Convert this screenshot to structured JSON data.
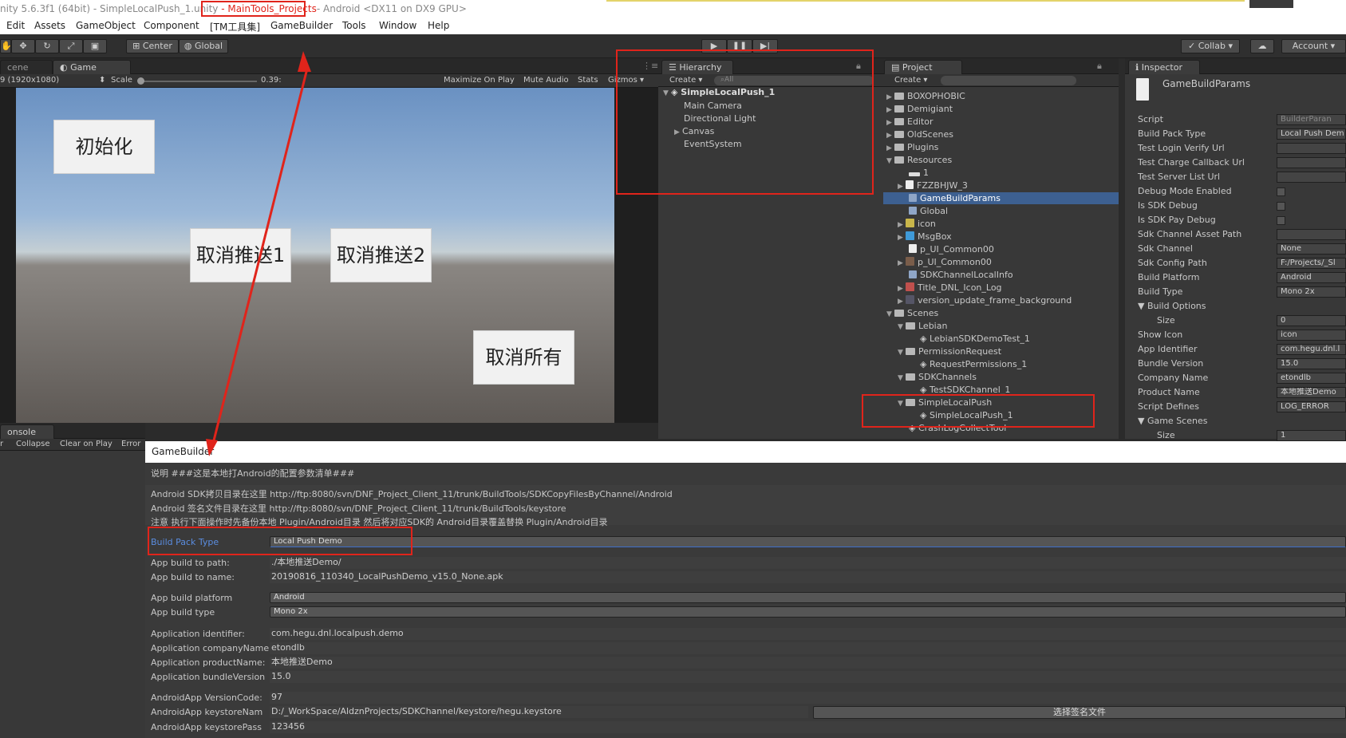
{
  "window": {
    "title": "nity 5.6.3f1 (64bit) - SimpleLocalPush_1.unity ",
    "project": "- MainTools_Projects",
    "platform": "- Android <DX11 on DX9 GPU>"
  },
  "menu": [
    "Edit",
    "Assets",
    "GameObject",
    "Component",
    "[TM工具集]",
    "GameBuilder",
    "Tools",
    "Window",
    "Help"
  ],
  "toolbar": {
    "center": "Center",
    "global": "Global",
    "collab": "Collab ▾",
    "account": "Account"
  },
  "scene_tabs": {
    "scene": "cene",
    "game": "Game"
  },
  "game_toolbar": {
    "resolution": "9 (1920x1080)",
    "scale_label": "Scale",
    "scale_value": "0.39:",
    "maximize": "Maximize On Play",
    "mute": "Mute Audio",
    "stats": "Stats",
    "gizmos": "Gizmos ▾"
  },
  "game_buttons": {
    "init": "初始化",
    "cancel1": "取消推送1",
    "cancel2": "取消推送2",
    "cancel_all": "取消所有"
  },
  "console": {
    "tab": "onsole",
    "buttons": [
      "r",
      "Collapse",
      "Clear on Play",
      "Error"
    ]
  },
  "hierarchy": {
    "tab": "Hierarchy",
    "create": "Create ▾",
    "search_placeholder": "All",
    "scene": "SimpleLocalPush_1",
    "items": [
      "Main Camera",
      "Directional Light",
      "Canvas",
      "EventSystem"
    ]
  },
  "project": {
    "tab": "Project",
    "create": "Create ▾",
    "items": [
      {
        "label": "BOXOPHOBIC"
      },
      {
        "label": "Demigiant"
      },
      {
        "label": "Editor"
      },
      {
        "label": "OldScenes"
      },
      {
        "label": "Plugins"
      },
      {
        "label": "Resources"
      },
      {
        "label": "1"
      },
      {
        "label": "FZZBHJW_3"
      },
      {
        "label": "GameBuildParams"
      },
      {
        "label": "Global"
      },
      {
        "label": "icon"
      },
      {
        "label": "MsgBox"
      },
      {
        "label": "p_UI_Common00"
      },
      {
        "label": "p_UI_Common00"
      },
      {
        "label": "SDKChannelLocalInfo"
      },
      {
        "label": "Title_DNL_Icon_Log"
      },
      {
        "label": "version_update_frame_background"
      },
      {
        "label": "Scenes"
      },
      {
        "label": "Lebian"
      },
      {
        "label": "LebianSDKDemoTest_1"
      },
      {
        "label": "PermissionRequest"
      },
      {
        "label": "RequestPermissions_1"
      },
      {
        "label": "SDKChannels"
      },
      {
        "label": "TestSDKChannel_1"
      },
      {
        "label": "SimpleLocalPush"
      },
      {
        "label": "SimpleLocalPush_1"
      },
      {
        "label": "CrashLogCollectTool"
      }
    ]
  },
  "inspector": {
    "tab": "Inspector",
    "object": "GameBuildParams",
    "fields": [
      {
        "label": "Script",
        "value": "BuilderParan"
      },
      {
        "label": "Build Pack Type",
        "value": "Local Push Dem"
      },
      {
        "label": "Test Login Verify Url",
        "value": ""
      },
      {
        "label": "Test Charge Callback Url",
        "value": ""
      },
      {
        "label": "Test Server List Url",
        "value": ""
      },
      {
        "label": "Debug Mode Enabled",
        "value": ""
      },
      {
        "label": "Is SDK Debug",
        "value": ""
      },
      {
        "label": "Is SDK Pay Debug",
        "value": ""
      },
      {
        "label": "Sdk Channel Asset Path",
        "value": ""
      },
      {
        "label": "Sdk Channel",
        "value": "None"
      },
      {
        "label": "Sdk Config Path",
        "value": "F:/Projects/_Sl"
      },
      {
        "label": "Build Platform",
        "value": "Android"
      },
      {
        "label": "Build Type",
        "value": "Mono 2x"
      },
      {
        "label": "Build Options",
        "value": ""
      },
      {
        "label": "Size",
        "value": "0"
      },
      {
        "label": "Show Icon",
        "value": "icon"
      },
      {
        "label": "App Identifier",
        "value": "com.hegu.dnl.l"
      },
      {
        "label": "Bundle Version",
        "value": "15.0"
      },
      {
        "label": "Company Name",
        "value": "etondlb"
      },
      {
        "label": "Product Name",
        "value": "本地推送Demo"
      },
      {
        "label": "Script Defines",
        "value": "LOG_ERROR"
      },
      {
        "label": "Game Scenes",
        "value": ""
      },
      {
        "label": "Size",
        "value": "1"
      }
    ]
  },
  "gamebuilder": {
    "title": "GameBuilder",
    "desc": "说明 ###这是本地打Android的配置参数清单###",
    "sdk_copy": "Android SDK拷贝目录在这里 http://ftp:8080/svn/DNF_Project_Client_11/trunk/BuildTools/SDKCopyFilesByChannel/Android",
    "sign_dir": "Android 签名文件目录在这里 http://ftp:8080/svn/DNF_Project_Client_11/trunk/BuildTools/keystore",
    "note": "注意 执行下面操作时先备份本地 Plugin/Android目录 然后将对应SDK的 Android目录覆盖替换 Plugin/Android目录",
    "build_pack_type_label": "Build Pack Type",
    "build_pack_type": "Local Push Demo",
    "build_path_label": "App build to path:",
    "build_path": "./本地推送Demo/",
    "build_name_label": "App build to name:",
    "build_name": "20190816_110340_LocalPushDemo_v15.0_None.apk",
    "platform_label": "App build platform",
    "platform": "Android",
    "type_label": "App build type",
    "type": "Mono 2x",
    "identifier_label": "Application identifier:",
    "identifier": "com.hegu.dnl.localpush.demo",
    "company_label": "Application companyName",
    "company": "etondlb",
    "product_label": "Application productName:",
    "product": "本地推送Demo",
    "bundle_label": "Application bundleVersion",
    "bundle": "15.0",
    "version_code_label": "AndroidApp VersionCode:",
    "version_code": "97",
    "keystore_label": "AndroidApp keystoreNam",
    "keystore": "D:/_WorkSpace/AldznProjects/SDKChannel/keystore/hegu.keystore",
    "select_sign": "选择签名文件",
    "keystore_pass_label": "AndroidApp keystorePass",
    "keystore_pass": "123456"
  },
  "colors": {
    "annotation_red": "#e0241b",
    "selection_blue": "#3d6091",
    "link_blue": "#5a8de0"
  }
}
